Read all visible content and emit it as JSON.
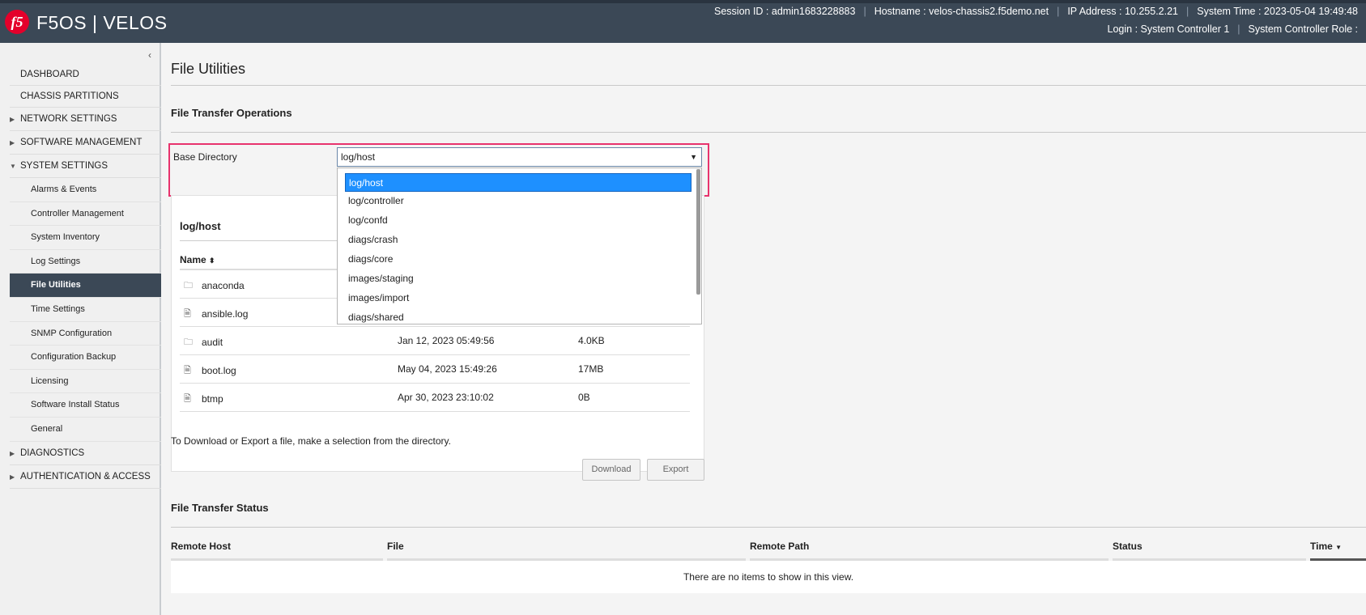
{
  "header": {
    "logo_text": "f5",
    "title": "F5OS | VELOS",
    "session": "Session ID : admin1683228883",
    "hostname": "Hostname : velos-chassis2.f5demo.net",
    "ip": "IP Address : 10.255.2.21",
    "time": "System Time : 2023-05-04 19:49:48",
    "login": "Login : System Controller 1",
    "role": "System Controller Role :"
  },
  "sidebar": {
    "collapse": "‹",
    "items": [
      {
        "label": "DASHBOARD"
      },
      {
        "label": "CHASSIS PARTITIONS"
      },
      {
        "label": "NETWORK SETTINGS"
      },
      {
        "label": "SOFTWARE MANAGEMENT"
      },
      {
        "label": "SYSTEM SETTINGS"
      },
      {
        "label": "DIAGNOSTICS"
      },
      {
        "label": "AUTHENTICATION & ACCESS"
      }
    ],
    "sub_items": [
      {
        "label": "Alarms & Events"
      },
      {
        "label": "Controller Management"
      },
      {
        "label": "System Inventory"
      },
      {
        "label": "Log Settings"
      },
      {
        "label": "File Utilities"
      },
      {
        "label": "Time Settings"
      },
      {
        "label": "SNMP Configuration"
      },
      {
        "label": "Configuration Backup"
      },
      {
        "label": "Licensing"
      },
      {
        "label": "Software Install Status"
      },
      {
        "label": "General"
      }
    ]
  },
  "main": {
    "page_title": "File Utilities",
    "transfer_title": "File Transfer Operations",
    "base_dir_label": "Base Directory",
    "base_dir_value": "log/host",
    "panel_title": "log/host",
    "col_name": "Name",
    "dropdown_options": [
      "log/host",
      "log/controller",
      "log/confd",
      "diags/crash",
      "diags/core",
      "images/staging",
      "images/import",
      "diags/shared"
    ],
    "files": [
      {
        "name": "anaconda",
        "type": "folder",
        "date": "",
        "size": ""
      },
      {
        "name": "ansible.log",
        "type": "file",
        "date": "",
        "size": ""
      },
      {
        "name": "audit",
        "type": "folder",
        "date": "Jan 12, 2023 05:49:56",
        "size": "4.0KB"
      },
      {
        "name": "boot.log",
        "type": "file",
        "date": "May 04, 2023 15:49:26",
        "size": "17MB"
      },
      {
        "name": "btmp",
        "type": "file",
        "date": "Apr 30, 2023 23:10:02",
        "size": "0B"
      }
    ],
    "hint": "To Download or Export a file, make a selection from the directory.",
    "download_label": "Download",
    "export_label": "Export",
    "status_title": "File Transfer Status",
    "status_cols": {
      "remote_host": "Remote Host",
      "file": "File",
      "remote_path": "Remote Path",
      "status": "Status",
      "time": "Time"
    },
    "empty_text": "There are no items to show in this view."
  },
  "colors": {
    "header_bg": "#3b4856",
    "highlight": "#e8336d",
    "selected_option": "#1e90ff",
    "logo": "#e4002b"
  }
}
